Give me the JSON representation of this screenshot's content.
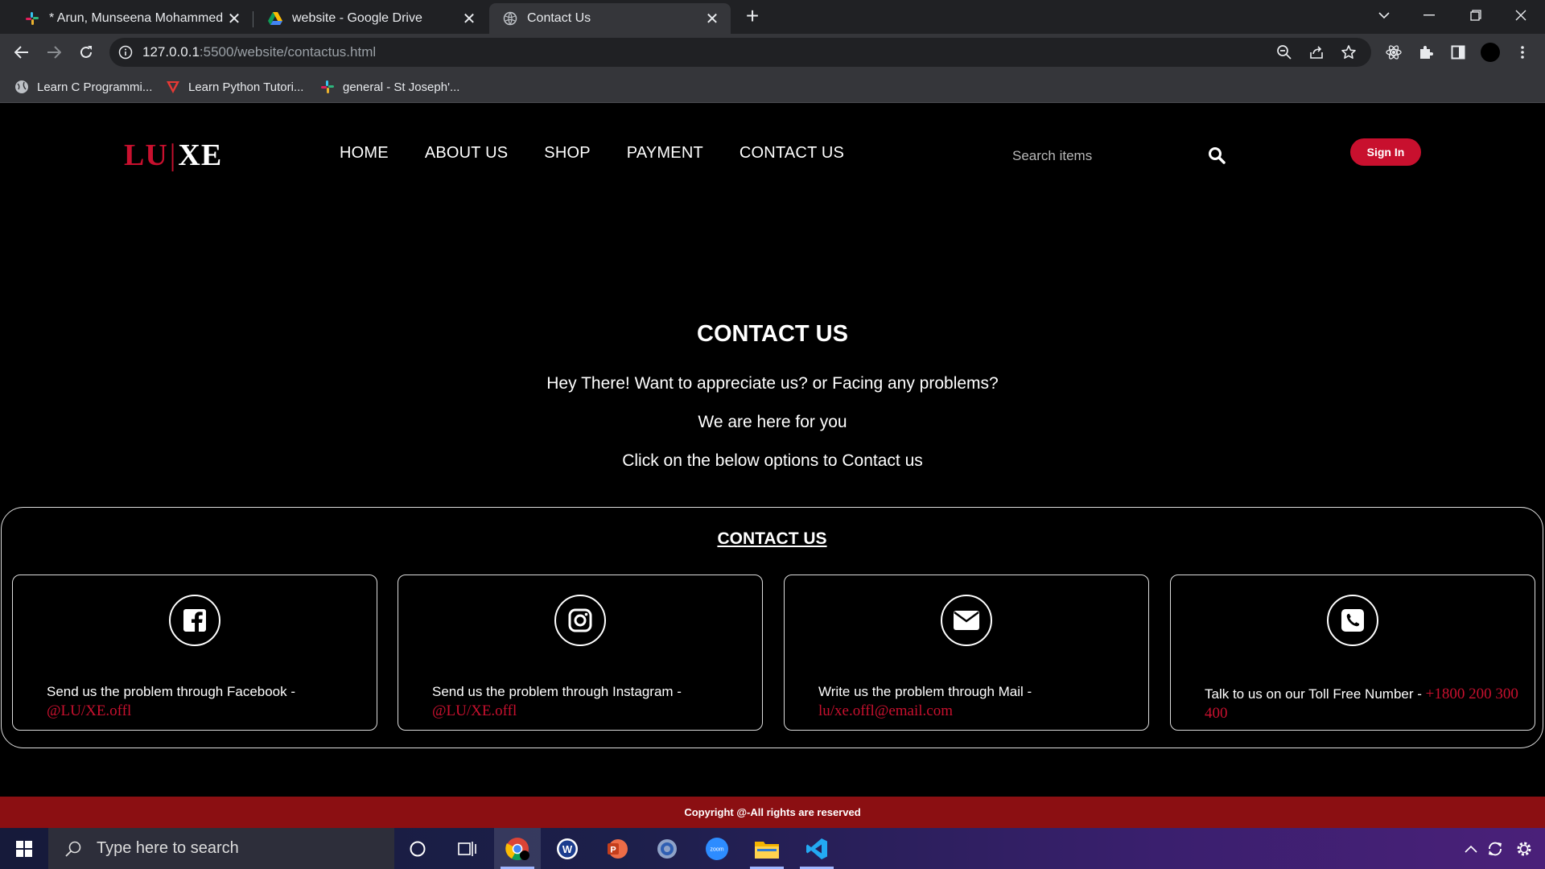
{
  "browser": {
    "tabs": [
      {
        "title": "* Arun, Munseena Mohammed -",
        "icon": "slack-icon"
      },
      {
        "title": "website - Google Drive",
        "icon": "google-drive-icon"
      },
      {
        "title": "Contact Us",
        "icon": "globe-icon"
      }
    ],
    "url_host": "127.0.0.1",
    "url_path": ":5500/website/contactus.html",
    "bookmarks": [
      {
        "label": "Learn C Programmi...",
        "icon": "globe-icon"
      },
      {
        "label": "Learn Python Tutori...",
        "icon": "tutorial-logo-icon"
      },
      {
        "label": "general - St Joseph'...",
        "icon": "slack-icon"
      }
    ]
  },
  "site": {
    "logo": {
      "left": "LU",
      "separator": "|",
      "right": "XE"
    },
    "nav": [
      "HOME",
      "ABOUT US",
      "SHOP",
      "PAYMENT",
      "CONTACT US"
    ],
    "search_placeholder": "Search items",
    "signin_label": "Sign In",
    "hero": {
      "title": "CONTACT US",
      "line1": "Hey There! Want to appreciate us? or Facing any problems?",
      "line2": "We are here for you",
      "line3": "Click on the below options to Contact us"
    },
    "contact": {
      "heading": "CONTACT US",
      "cards": [
        {
          "text": "Send us the problem through Facebook - ",
          "highlight": "@LU/XE.offl",
          "icon": "facebook-icon"
        },
        {
          "text": "Send us the problem through Instagram - ",
          "highlight": "@LU/XE.offl",
          "icon": "instagram-icon"
        },
        {
          "text": "Write us the problem through Mail - ",
          "highlight": "lu/xe.offl@email.com",
          "icon": "mail-icon"
        },
        {
          "text": "Talk to us on our Toll Free Number - ",
          "highlight": "+1800 200 300 400",
          "icon": "phone-icon"
        }
      ]
    },
    "footer": "Copyright @-All rights are reserved",
    "accent_color": "#c8102e"
  },
  "taskbar": {
    "search_placeholder": "Type here to search",
    "apps": [
      "cortana-icon",
      "task-view-icon",
      "chrome-icon",
      "word-icon",
      "powerpoint-icon",
      "settings-icon",
      "zoom-icon",
      "file-explorer-icon",
      "vscode-icon"
    ],
    "zoom_label": "zoom",
    "word_letter": "W",
    "powerpoint_letter": "P"
  }
}
